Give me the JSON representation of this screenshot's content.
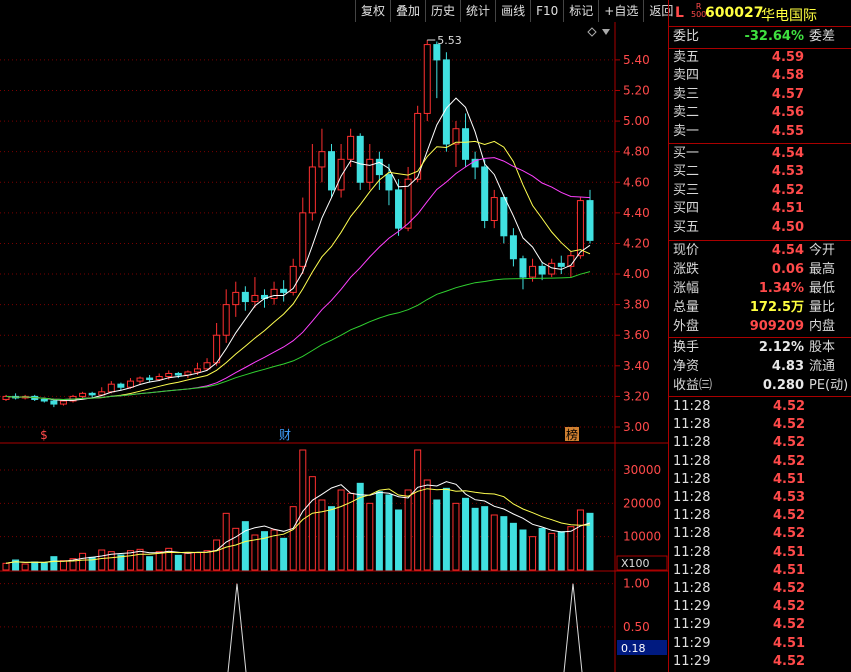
{
  "toolbar": {
    "buttons": [
      "复权",
      "叠加",
      "历史",
      "统计",
      "画线",
      "F10",
      "标记",
      "+自选",
      "返回"
    ]
  },
  "stock": {
    "flag": "L",
    "badge_top": "R",
    "badge_bottom": "500",
    "code": "600027",
    "name": "华电国际"
  },
  "quote": {
    "weibi": {
      "label": "委比",
      "value": "-32.64%",
      "label2": "委差"
    },
    "asks": [
      {
        "label": "卖五",
        "price": "4.59"
      },
      {
        "label": "卖四",
        "price": "4.58"
      },
      {
        "label": "卖三",
        "price": "4.57"
      },
      {
        "label": "卖二",
        "price": "4.56"
      },
      {
        "label": "卖一",
        "price": "4.55"
      }
    ],
    "bids": [
      {
        "label": "买一",
        "price": "4.54"
      },
      {
        "label": "买二",
        "price": "4.53"
      },
      {
        "label": "买三",
        "price": "4.52"
      },
      {
        "label": "买四",
        "price": "4.51"
      },
      {
        "label": "买五",
        "price": "4.50"
      }
    ],
    "stats": [
      {
        "label": "现价",
        "value": "4.54",
        "label2": "今开"
      },
      {
        "label": "涨跌",
        "value": "0.06",
        "label2": "最高"
      },
      {
        "label": "涨幅",
        "value": "1.34%",
        "label2": "最低"
      },
      {
        "label": "总量",
        "value": "172.5万",
        "label2": "量比"
      },
      {
        "label": "外盘",
        "value": "909209",
        "label2": "内盘"
      }
    ],
    "fundamentals": [
      {
        "label": "换手",
        "value": "2.12%",
        "label2": "股本"
      },
      {
        "label": "净资",
        "value": "4.83",
        "label2": "流通"
      },
      {
        "label": "收益㈢",
        "value": "0.280",
        "label2": "PE(动)"
      }
    ],
    "ticks": [
      {
        "time": "11:28",
        "price": "4.52"
      },
      {
        "time": "11:28",
        "price": "4.52"
      },
      {
        "time": "11:28",
        "price": "4.52"
      },
      {
        "time": "11:28",
        "price": "4.52"
      },
      {
        "time": "11:28",
        "price": "4.51"
      },
      {
        "time": "11:28",
        "price": "4.53"
      },
      {
        "time": "11:28",
        "price": "4.52"
      },
      {
        "time": "11:28",
        "price": "4.52"
      },
      {
        "time": "11:28",
        "price": "4.51"
      },
      {
        "time": "11:28",
        "price": "4.51"
      },
      {
        "time": "11:28",
        "price": "4.52"
      },
      {
        "time": "11:29",
        "price": "4.52"
      },
      {
        "time": "11:29",
        "price": "4.52"
      },
      {
        "time": "11:29",
        "price": "4.51"
      },
      {
        "time": "11:29",
        "price": "4.52"
      }
    ]
  },
  "chart": {
    "price_axis": [
      "5.40",
      "5.20",
      "5.00",
      "4.80",
      "4.60",
      "4.40",
      "4.20",
      "4.00",
      "3.80",
      "3.60",
      "3.40",
      "3.20",
      "3.00"
    ],
    "high_label": "5.53",
    "markers": [
      "$",
      "财",
      "榜"
    ],
    "volume_axis": [
      "30000",
      "20000",
      "10000"
    ],
    "volume_unit": "X100",
    "indicator_axis": [
      "1.00",
      "0.50"
    ],
    "indicator_value": "0.18"
  },
  "chart_data": {
    "type": "candlestick",
    "y_range": [
      3.0,
      5.53
    ],
    "candles": [
      [
        3.18,
        3.2,
        3.17,
        3.21
      ],
      [
        3.2,
        3.19,
        3.18,
        3.22
      ],
      [
        3.19,
        3.2,
        3.18,
        3.21
      ],
      [
        3.2,
        3.18,
        3.17,
        3.21
      ],
      [
        3.18,
        3.17,
        3.16,
        3.19
      ],
      [
        3.17,
        3.15,
        3.13,
        3.18
      ],
      [
        3.15,
        3.17,
        3.14,
        3.18
      ],
      [
        3.17,
        3.2,
        3.16,
        3.21
      ],
      [
        3.2,
        3.22,
        3.19,
        3.23
      ],
      [
        3.22,
        3.21,
        3.19,
        3.23
      ],
      [
        3.21,
        3.23,
        3.2,
        3.26
      ],
      [
        3.23,
        3.28,
        3.22,
        3.3
      ],
      [
        3.28,
        3.26,
        3.24,
        3.29
      ],
      [
        3.26,
        3.3,
        3.25,
        3.32
      ],
      [
        3.3,
        3.32,
        3.28,
        3.33
      ],
      [
        3.32,
        3.31,
        3.29,
        3.34
      ],
      [
        3.31,
        3.33,
        3.3,
        3.35
      ],
      [
        3.33,
        3.35,
        3.31,
        3.37
      ],
      [
        3.35,
        3.34,
        3.32,
        3.36
      ],
      [
        3.34,
        3.36,
        3.32,
        3.37
      ],
      [
        3.36,
        3.38,
        3.34,
        3.42
      ],
      [
        3.38,
        3.42,
        3.37,
        3.45
      ],
      [
        3.42,
        3.6,
        3.4,
        3.68
      ],
      [
        3.6,
        3.8,
        3.55,
        3.9
      ],
      [
        3.8,
        3.88,
        3.72,
        3.95
      ],
      [
        3.88,
        3.82,
        3.76,
        3.92
      ],
      [
        3.82,
        3.86,
        3.78,
        3.98
      ],
      [
        3.86,
        3.84,
        3.78,
        3.9
      ],
      [
        3.84,
        3.9,
        3.8,
        3.95
      ],
      [
        3.9,
        3.88,
        3.82,
        3.96
      ],
      [
        3.88,
        4.05,
        3.86,
        4.1
      ],
      [
        4.05,
        4.4,
        4.0,
        4.5
      ],
      [
        4.4,
        4.7,
        4.35,
        4.85
      ],
      [
        4.7,
        4.8,
        4.6,
        4.95
      ],
      [
        4.8,
        4.55,
        4.5,
        4.85
      ],
      [
        4.55,
        4.75,
        4.5,
        4.85
      ],
      [
        4.75,
        4.9,
        4.7,
        4.95
      ],
      [
        4.9,
        4.6,
        4.55,
        4.92
      ],
      [
        4.6,
        4.75,
        4.55,
        4.85
      ],
      [
        4.75,
        4.65,
        4.55,
        4.8
      ],
      [
        4.65,
        4.55,
        4.45,
        4.72
      ],
      [
        4.55,
        4.3,
        4.25,
        4.62
      ],
      [
        4.3,
        4.62,
        4.28,
        4.7
      ],
      [
        4.62,
        5.05,
        4.6,
        5.1
      ],
      [
        5.05,
        5.5,
        5.0,
        5.53
      ],
      [
        5.5,
        5.4,
        5.15,
        5.52
      ],
      [
        5.4,
        4.85,
        4.8,
        5.45
      ],
      [
        4.85,
        4.95,
        4.7,
        5.0
      ],
      [
        4.95,
        4.75,
        4.7,
        5.05
      ],
      [
        4.75,
        4.7,
        4.62,
        4.8
      ],
      [
        4.7,
        4.35,
        4.3,
        4.75
      ],
      [
        4.35,
        4.5,
        4.3,
        4.55
      ],
      [
        4.5,
        4.25,
        4.2,
        4.52
      ],
      [
        4.25,
        4.1,
        4.05,
        4.3
      ],
      [
        4.1,
        3.98,
        3.9,
        4.12
      ],
      [
        3.98,
        4.05,
        3.95,
        4.1
      ],
      [
        4.05,
        4.0,
        3.96,
        4.08
      ],
      [
        4.0,
        4.07,
        3.98,
        4.1
      ],
      [
        4.07,
        4.05,
        4.0,
        4.12
      ],
      [
        4.05,
        4.12,
        3.98,
        4.15
      ],
      [
        4.12,
        4.48,
        4.1,
        4.5
      ],
      [
        4.48,
        4.22,
        4.2,
        4.55
      ]
    ],
    "volumes": [
      20,
      30,
      18,
      24,
      22,
      40,
      28,
      34,
      50,
      38,
      60,
      55,
      45,
      58,
      62,
      40,
      55,
      65,
      44,
      50,
      52,
      58,
      90,
      170,
      125,
      145,
      105,
      115,
      120,
      95,
      190,
      360,
      280,
      210,
      190,
      240,
      230,
      260,
      200,
      235,
      225,
      180,
      240,
      360,
      270,
      210,
      245,
      200,
      215,
      185,
      190,
      165,
      160,
      140,
      120,
      100,
      125,
      110,
      115,
      130,
      180,
      170
    ],
    "volume_range": [
      0,
      36000
    ],
    "ma_price": [
      [
        0.3,
        0.35,
        0.5,
        0.72,
        0.88,
        0.9,
        0.82,
        0.65,
        0.55,
        0.55
      ],
      [
        0.35,
        0.4,
        0.55,
        0.75,
        0.82,
        0.76,
        0.6,
        0.55,
        0.5
      ],
      [
        0.35,
        0.45,
        0.6,
        0.7,
        0.73,
        0.7,
        0.66,
        0.6
      ],
      [
        0.35,
        0.4,
        0.5,
        0.58,
        0.62,
        0.63
      ]
    ]
  }
}
